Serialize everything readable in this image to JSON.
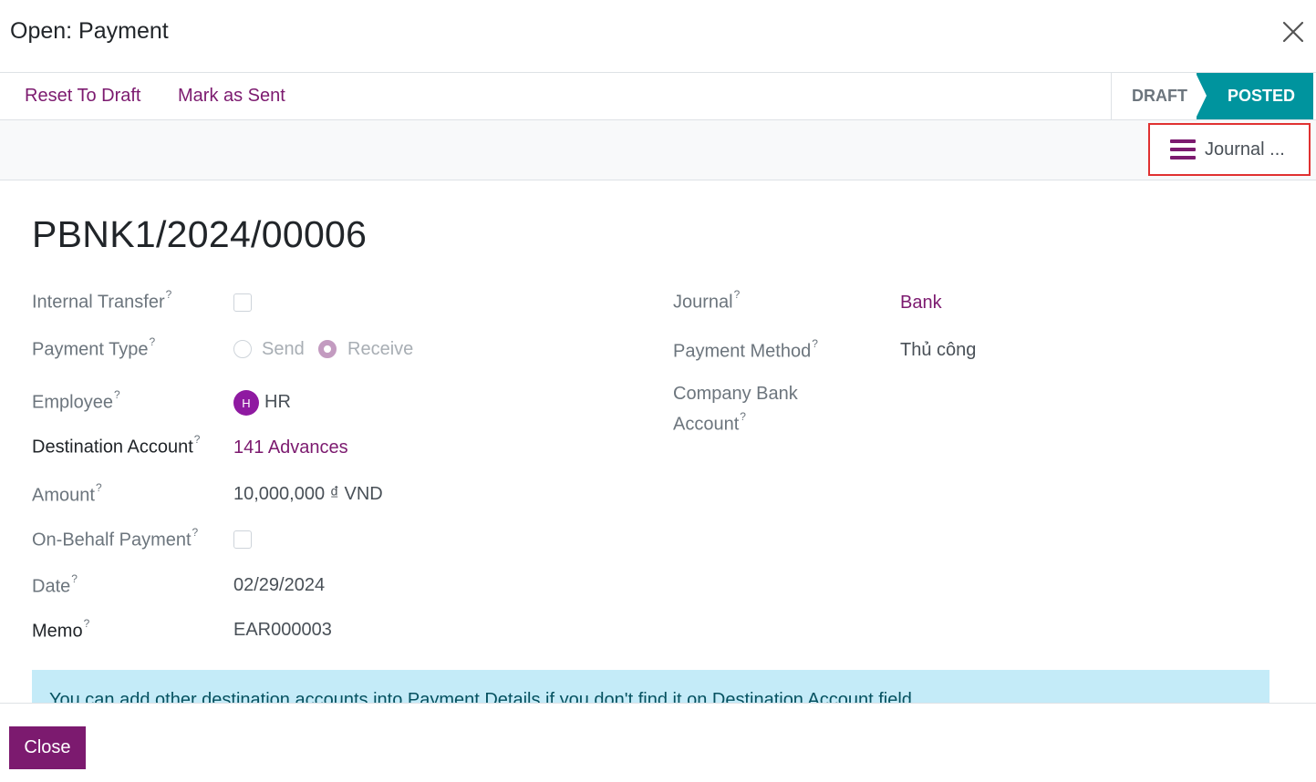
{
  "dialog": {
    "title": "Open: Payment"
  },
  "statusbar": {
    "actions": [
      "Reset To Draft",
      "Mark as Sent"
    ],
    "stages": [
      "DRAFT",
      "POSTED"
    ],
    "active_stage": "POSTED"
  },
  "smart_button": {
    "icon": "bars-icon",
    "label": "Journal ..."
  },
  "record": {
    "name": "PBNK1/2024/00006",
    "left_fields": {
      "internal_transfer": {
        "label": "Internal Transfer",
        "checked": false
      },
      "payment_type": {
        "label": "Payment Type",
        "options": [
          "Send",
          "Receive"
        ],
        "selected": "Receive"
      },
      "employee": {
        "label": "Employee",
        "avatar_initial": "H",
        "value": "HR"
      },
      "destination_account": {
        "label": "Destination Account",
        "value": "141 Advances"
      },
      "amount": {
        "label": "Amount",
        "value": "10,000,000 ₫ VND"
      },
      "on_behalf_payment": {
        "label": "On-Behalf Payment",
        "checked": false
      },
      "date": {
        "label": "Date",
        "value": "02/29/2024"
      },
      "memo": {
        "label": "Memo",
        "value": "EAR000003"
      }
    },
    "right_fields": {
      "journal": {
        "label": "Journal",
        "value": "Bank"
      },
      "payment_method": {
        "label": "Payment Method",
        "value": "Thủ công"
      },
      "company_bank_account": {
        "label_line1": "Company Bank",
        "label_line2": "Account",
        "value": ""
      }
    },
    "help_mark": "?"
  },
  "alert": {
    "text": "You can add other destination accounts into Payment Details if you don't find it on Destination Account field."
  },
  "footer": {
    "close_label": "Close"
  },
  "colors": {
    "brand": "#7c1a6f",
    "posted": "#00949e",
    "highlight_border": "#e03131",
    "alert_bg": "#c4ebf8",
    "avatar": "#8f1aa1"
  }
}
